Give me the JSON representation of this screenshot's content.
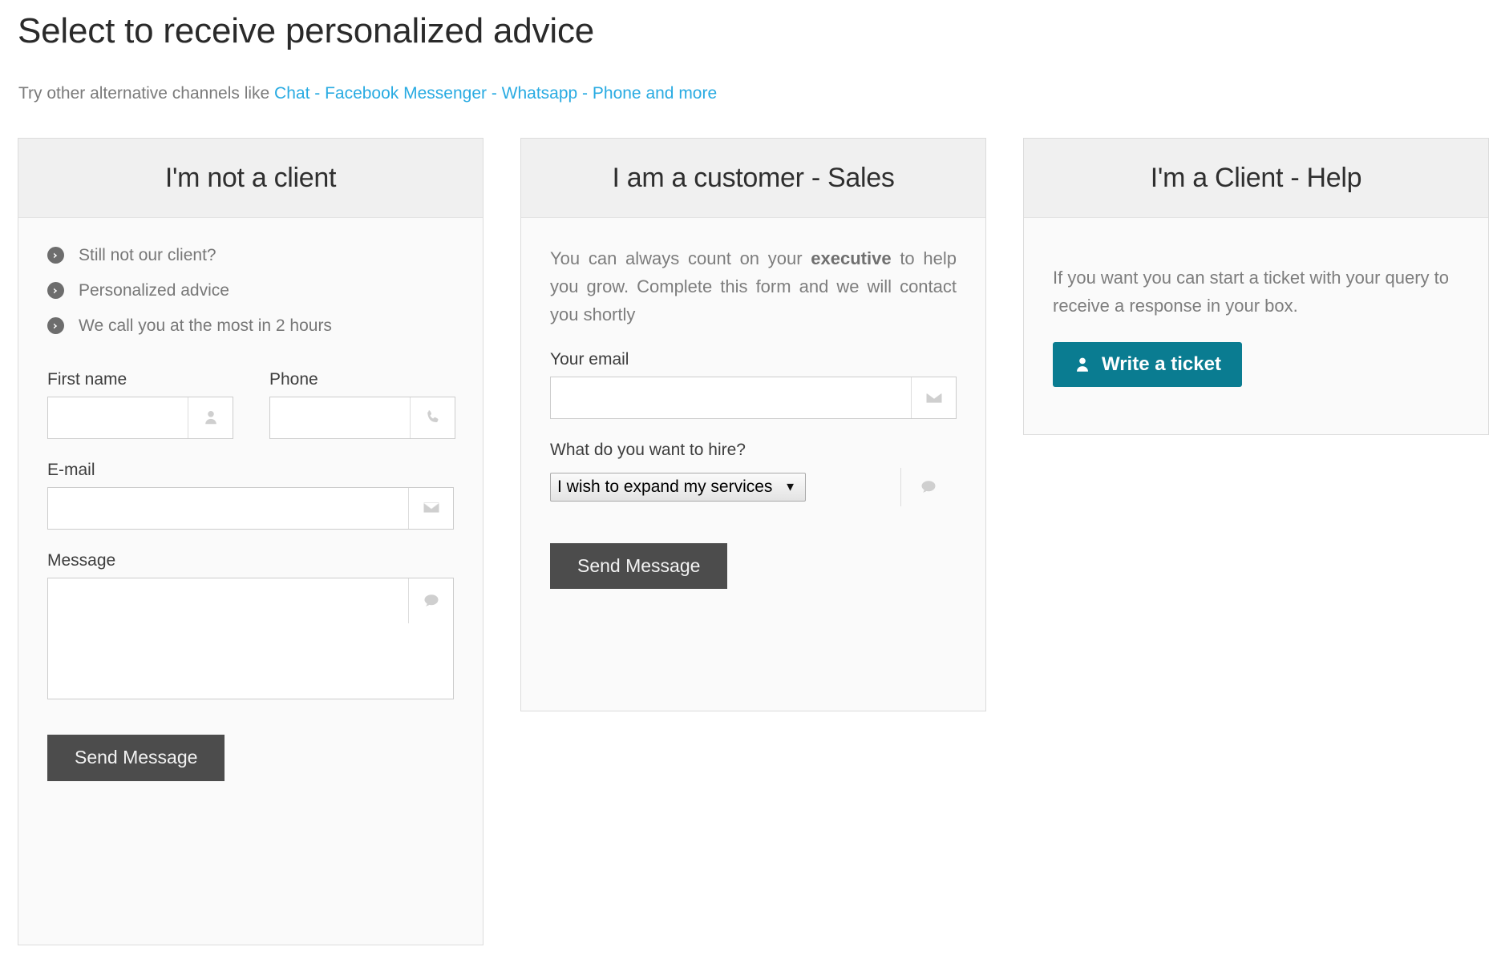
{
  "header": {
    "title": "Select to receive personalized advice",
    "subline_prefix": "Try other alternative channels like ",
    "subline_link": "Chat - Facebook Messenger - Whatsapp - Phone and more",
    "link_color": "#29abe2"
  },
  "cards": {
    "not_client": {
      "title": "I'm not a client",
      "bullets": [
        {
          "icon": "arrow-circle-right-icon",
          "label": "Still not our client?"
        },
        {
          "icon": "arrow-circle-right-icon",
          "label": "Personalized advice"
        },
        {
          "icon": "arrow-circle-right-icon",
          "label": "We call you at the most in 2 hours"
        }
      ],
      "fields": {
        "first_name": {
          "label": "First name",
          "value": "",
          "placeholder": "",
          "icon": "user-icon"
        },
        "phone": {
          "label": "Phone",
          "value": "",
          "placeholder": "",
          "icon": "phone-icon"
        },
        "email": {
          "label": "E-mail",
          "value": "",
          "placeholder": "",
          "icon": "envelope-icon"
        },
        "message": {
          "label": "Message",
          "value": "",
          "placeholder": "",
          "icon": "comment-icon"
        }
      },
      "submit_label": "Send Message",
      "submit_color": "#4c4c4c"
    },
    "sales": {
      "title": "I am a customer - Sales",
      "intro_before": "You can always count on your ",
      "intro_bold": "executive",
      "intro_after": " to help you grow. Complete this form and we will contact you shortly",
      "fields": {
        "email": {
          "label": "Your email",
          "value": "",
          "placeholder": "",
          "icon": "envelope-icon"
        },
        "hire": {
          "label": "What do you want to hire?",
          "selected": "I wish to expand my services",
          "options": [
            "I wish to expand my services"
          ],
          "caret": "▼",
          "side_icon": "comment-icon"
        }
      },
      "submit_label": "Send Message",
      "submit_color": "#4c4c4c"
    },
    "help": {
      "title": "I'm a Client - Help",
      "text": "If you want you can start a ticket with your query to receive a response in your box.",
      "ticket_button_label": "Write a ticket",
      "ticket_button_icon": "user-icon",
      "ticket_button_color": "#0a7c91"
    }
  }
}
